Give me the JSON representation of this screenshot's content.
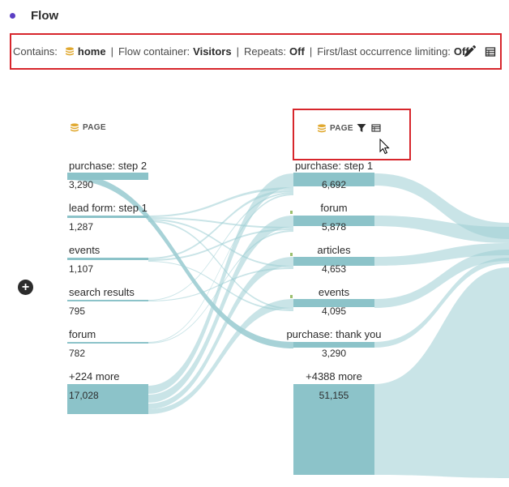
{
  "title": "Flow",
  "settings": {
    "contains_label": "Contains:",
    "contains_value": "home",
    "container_label": "Flow container:",
    "container_value": "Visitors",
    "repeats_label": "Repeats:",
    "repeats_value": "Off",
    "limiting_label": "First/last occurrence limiting:",
    "limiting_value": "Off",
    "separator": "|"
  },
  "columns": [
    {
      "header": "PAGE"
    },
    {
      "header": "PAGE"
    }
  ],
  "left_nodes": [
    {
      "label": "purchase: step 2",
      "count": "3,290"
    },
    {
      "label": "lead form: step 1",
      "count": "1,287"
    },
    {
      "label": "events",
      "count": "1,107"
    },
    {
      "label": "search results",
      "count": "795"
    },
    {
      "label": "forum",
      "count": "782"
    },
    {
      "label": "+224 more",
      "count": "17,028"
    }
  ],
  "right_nodes": [
    {
      "label": "purchase: step 1",
      "count": "6,692"
    },
    {
      "label": "forum",
      "count": "5,878"
    },
    {
      "label": "articles",
      "count": "4,653"
    },
    {
      "label": "events",
      "count": "4,095"
    },
    {
      "label": "purchase: thank you",
      "count": "3,290"
    },
    {
      "label": "+4388 more",
      "count": "51,155"
    }
  ],
  "add_symbol": "+",
  "colors": {
    "accent": "#5b3fc4",
    "highlight_border": "#d7262c",
    "flow_fill": "#9dcdd3",
    "node_fill": "#8cc3c9",
    "dimension_icon": "#e0a82e"
  },
  "icons": {
    "dimension": "dimension-icon",
    "edit": "pencil-icon",
    "table": "table-icon",
    "filter": "filter-icon",
    "cursor": "mouse-cursor-icon"
  }
}
